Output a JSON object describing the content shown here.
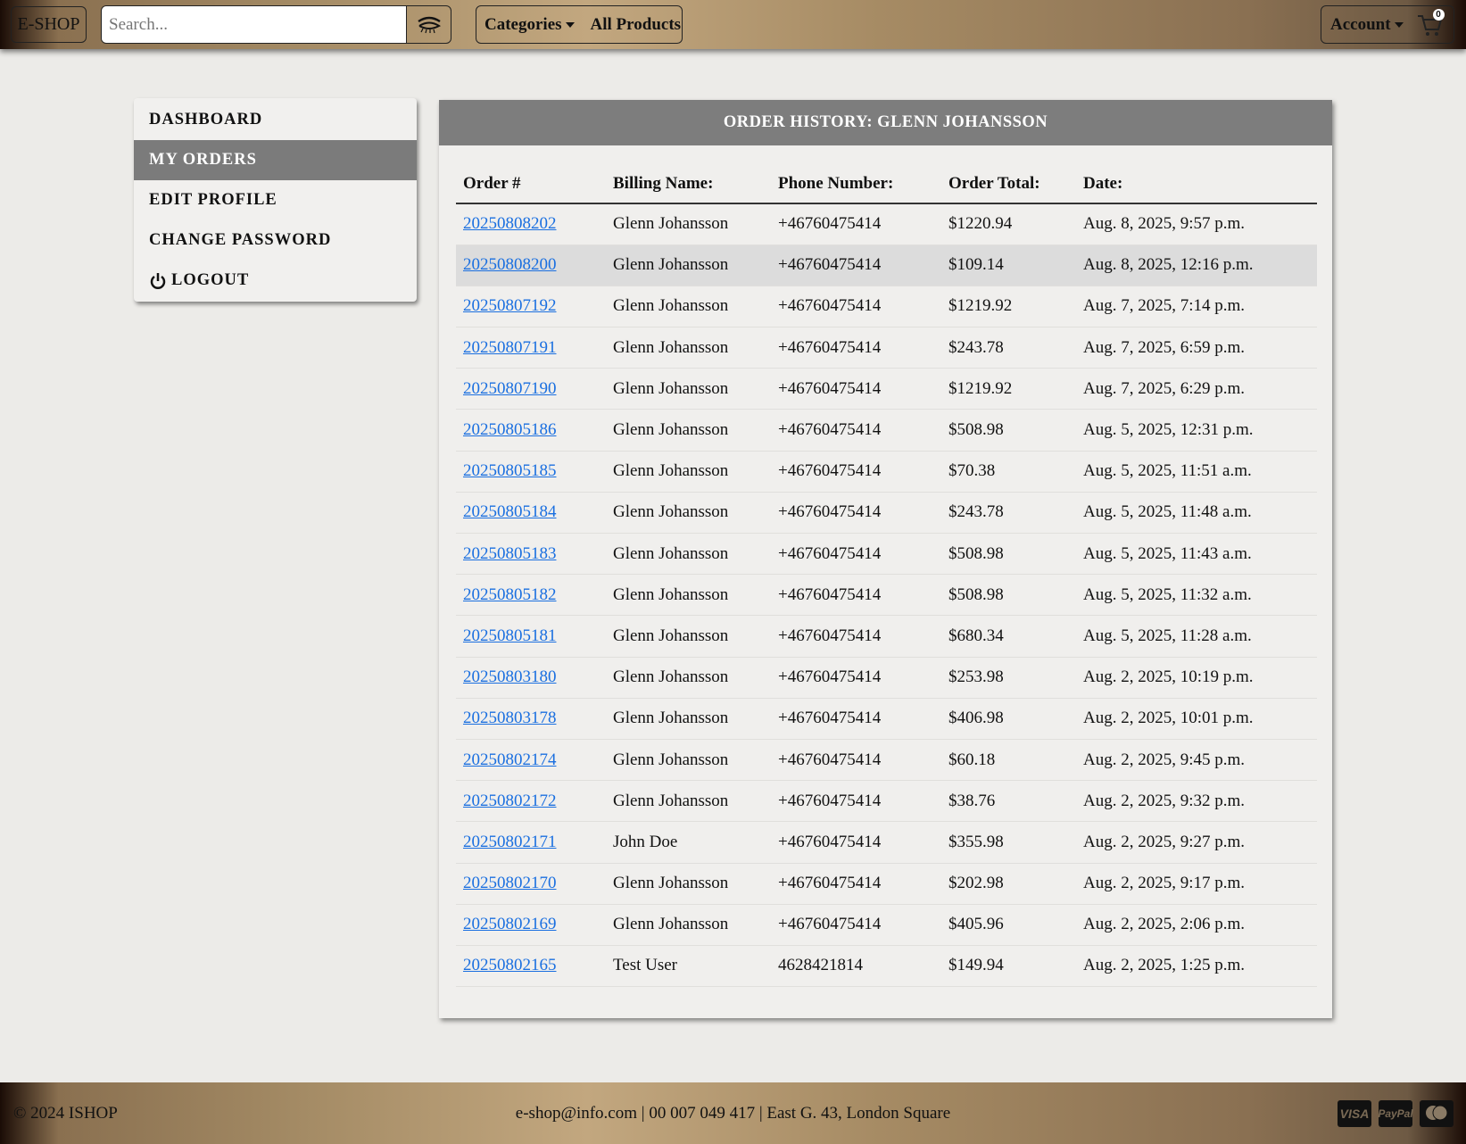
{
  "header": {
    "brand": "E-SHOP",
    "search_placeholder": "Search...",
    "categories": "Categories",
    "all_products": "All Products",
    "account": "Account",
    "cart_count": "0"
  },
  "sidebar": {
    "items": [
      {
        "label": "DASHBOARD"
      },
      {
        "label": "MY ORDERS"
      },
      {
        "label": "EDIT PROFILE"
      },
      {
        "label": "CHANGE PASSWORD"
      },
      {
        "label": "LOGOUT"
      }
    ]
  },
  "main": {
    "title": "ORDER HISTORY: GLENN JOHANSSON",
    "columns": [
      "Order #",
      "Billing Name:",
      "Phone Number:",
      "Order Total:",
      "Date:"
    ],
    "rows": [
      [
        "20250808202",
        "Glenn Johansson",
        "+46760475414",
        "$1220.94",
        "Aug. 8, 2025, 9:57 p.m."
      ],
      [
        "20250808200",
        "Glenn Johansson",
        "+46760475414",
        "$109.14",
        "Aug. 8, 2025, 12:16 p.m."
      ],
      [
        "20250807192",
        "Glenn Johansson",
        "+46760475414",
        "$1219.92",
        "Aug. 7, 2025, 7:14 p.m."
      ],
      [
        "20250807191",
        "Glenn Johansson",
        "+46760475414",
        "$243.78",
        "Aug. 7, 2025, 6:59 p.m."
      ],
      [
        "20250807190",
        "Glenn Johansson",
        "+46760475414",
        "$1219.92",
        "Aug. 7, 2025, 6:29 p.m."
      ],
      [
        "20250805186",
        "Glenn Johansson",
        "+46760475414",
        "$508.98",
        "Aug. 5, 2025, 12:31 p.m."
      ],
      [
        "20250805185",
        "Glenn Johansson",
        "+46760475414",
        "$70.38",
        "Aug. 5, 2025, 11:51 a.m."
      ],
      [
        "20250805184",
        "Glenn Johansson",
        "+46760475414",
        "$243.78",
        "Aug. 5, 2025, 11:48 a.m."
      ],
      [
        "20250805183",
        "Glenn Johansson",
        "+46760475414",
        "$508.98",
        "Aug. 5, 2025, 11:43 a.m."
      ],
      [
        "20250805182",
        "Glenn Johansson",
        "+46760475414",
        "$508.98",
        "Aug. 5, 2025, 11:32 a.m."
      ],
      [
        "20250805181",
        "Glenn Johansson",
        "+46760475414",
        "$680.34",
        "Aug. 5, 2025, 11:28 a.m."
      ],
      [
        "20250803180",
        "Glenn Johansson",
        "+46760475414",
        "$253.98",
        "Aug. 2, 2025, 10:19 p.m."
      ],
      [
        "20250803178",
        "Glenn Johansson",
        "+46760475414",
        "$406.98",
        "Aug. 2, 2025, 10:01 p.m."
      ],
      [
        "20250802174",
        "Glenn Johansson",
        "+46760475414",
        "$60.18",
        "Aug. 2, 2025, 9:45 p.m."
      ],
      [
        "20250802172",
        "Glenn Johansson",
        "+46760475414",
        "$38.76",
        "Aug. 2, 2025, 9:32 p.m."
      ],
      [
        "20250802171",
        "John Doe",
        "+46760475414",
        "$355.98",
        "Aug. 2, 2025, 9:27 p.m."
      ],
      [
        "20250802170",
        "Glenn Johansson",
        "+46760475414",
        "$202.98",
        "Aug. 2, 2025, 9:17 p.m."
      ],
      [
        "20250802169",
        "Glenn Johansson",
        "+46760475414",
        "$405.96",
        "Aug. 2, 2025, 2:06 p.m."
      ],
      [
        "20250802165",
        "Test User",
        "4628421814",
        "$149.94",
        "Aug. 2, 2025, 1:25 p.m."
      ]
    ]
  },
  "footer": {
    "copyright": "© 2024 ISHOP",
    "contact": "e-shop@info.com | 00 007 049 417 | East G. 43, London Square",
    "payments": [
      "VISA",
      "PayPal",
      "mastercard"
    ]
  },
  "colors": {
    "link": "#1a6fe0",
    "active": "#7b7b7b"
  }
}
